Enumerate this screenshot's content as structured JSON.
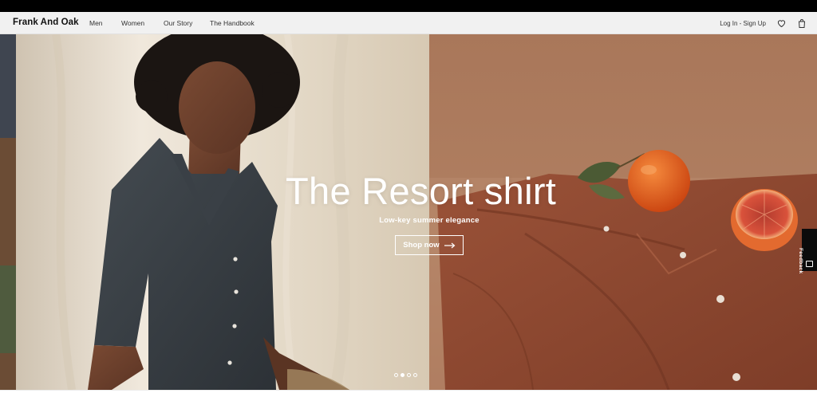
{
  "nav": {
    "brand": "Frank And Oak",
    "links": [
      "Men",
      "Women",
      "Our Story",
      "The Handbook"
    ],
    "login": "Log In - Sign Up",
    "icons": [
      "heart-icon",
      "bag-icon"
    ]
  },
  "hero": {
    "title": "The Resort shirt",
    "subtitle": "Low-key summer elegance",
    "cta_label": "Shop now",
    "cta_icon": "arrow-right-icon",
    "carousel": {
      "count": 4,
      "active_index": 2
    }
  },
  "feedback_tab": {
    "label": "Feedback"
  },
  "colors": {
    "nav_bg": "#f1f1f1",
    "topbar": "#000000",
    "left_panel": "#ece4d7",
    "right_panel": "#a9775a",
    "shirt_dark": "#3b4147",
    "shirt_rust": "#8e4a33",
    "orange": "#e3591b"
  }
}
